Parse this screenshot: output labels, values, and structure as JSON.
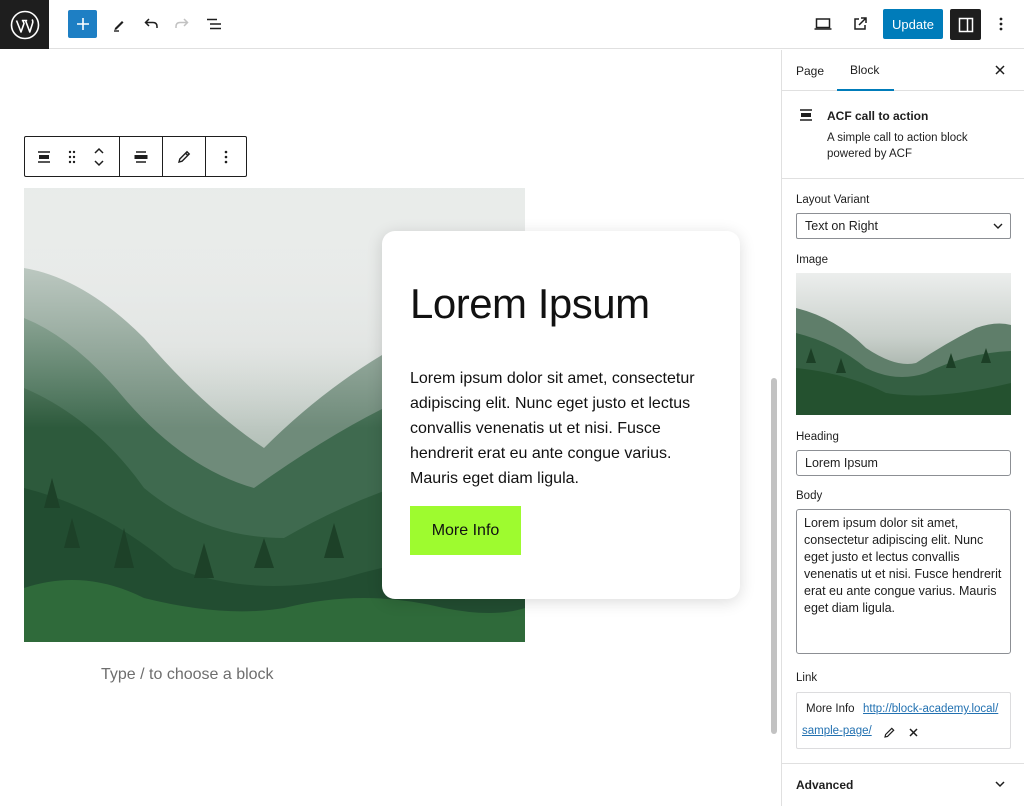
{
  "toolbar": {
    "update_label": "Update"
  },
  "block_toolbar": {},
  "cta": {
    "heading": "Lorem Ipsum",
    "body": "Lorem ipsum dolor sit amet, consectetur adipiscing elit. Nunc eget justo et lectus convallis venenatis ut et nisi. Fusce hendrerit erat eu ante congue varius. Mauris eget diam ligula.",
    "button_label": "More Info"
  },
  "canvas": {
    "appender_placeholder": "Type / to choose a block"
  },
  "sidebar": {
    "tabs": [
      {
        "label": "Page",
        "active": false
      },
      {
        "label": "Block",
        "active": true
      }
    ],
    "block_card": {
      "title": "ACF call to action",
      "description": "A simple call to action block powered by ACF"
    },
    "fields": {
      "layout_variant_label": "Layout Variant",
      "layout_variant_value": "Text on Right",
      "image_label": "Image",
      "heading_label": "Heading",
      "heading_value": "Lorem Ipsum",
      "body_label": "Body",
      "body_value": "Lorem ipsum dolor sit amet, consectetur adipiscing elit. Nunc eget justo et lectus convallis venenatis ut et nisi. Fusce hendrerit erat eu ante congue varius. Mauris eget diam ligula.",
      "link_label": "Link",
      "link_title": "More Info",
      "link_url_line1": "http://block-academy.local/",
      "link_url_line2": "sample-page/"
    },
    "advanced_label": "Advanced"
  },
  "colors": {
    "accent": "#007cba",
    "cta_button": "#9efb2f",
    "dark": "#1e1e1e"
  }
}
